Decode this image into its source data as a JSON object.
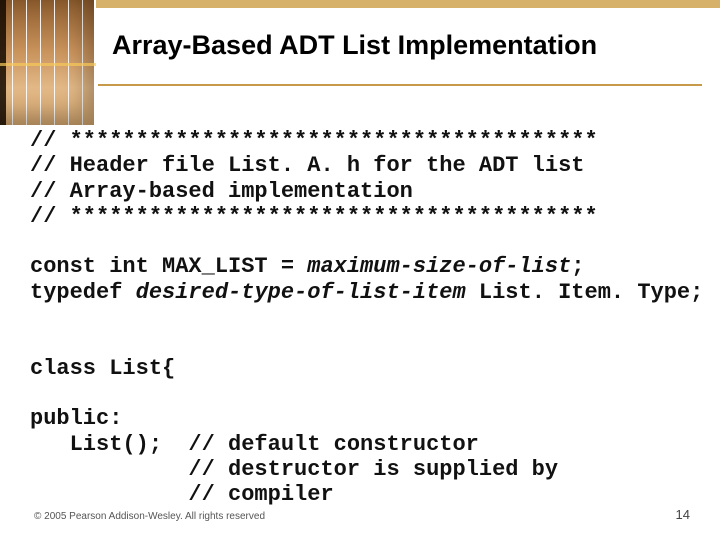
{
  "title": "Array-Based ADT List Implementation",
  "code": {
    "l1": "// ****************************************",
    "l2": "// Header file List. A. h for the ADT list",
    "l3": "// Array-based implementation",
    "l4": "// ****************************************",
    "l5a": "const int MAX_LIST = ",
    "l5b": "maximum-size-of-list",
    "l5c": ";",
    "l6a": "typedef ",
    "l6b": "desired-type-of-list-item",
    "l6c": " List. Item. Type;",
    "l7": "class List{",
    "l8": "public:",
    "l9": "   List();  // default constructor",
    "l10": "            // destructor is supplied by",
    "l11": "            // compiler"
  },
  "footer": "© 2005 Pearson Addison-Wesley. All rights reserved",
  "page": "14"
}
